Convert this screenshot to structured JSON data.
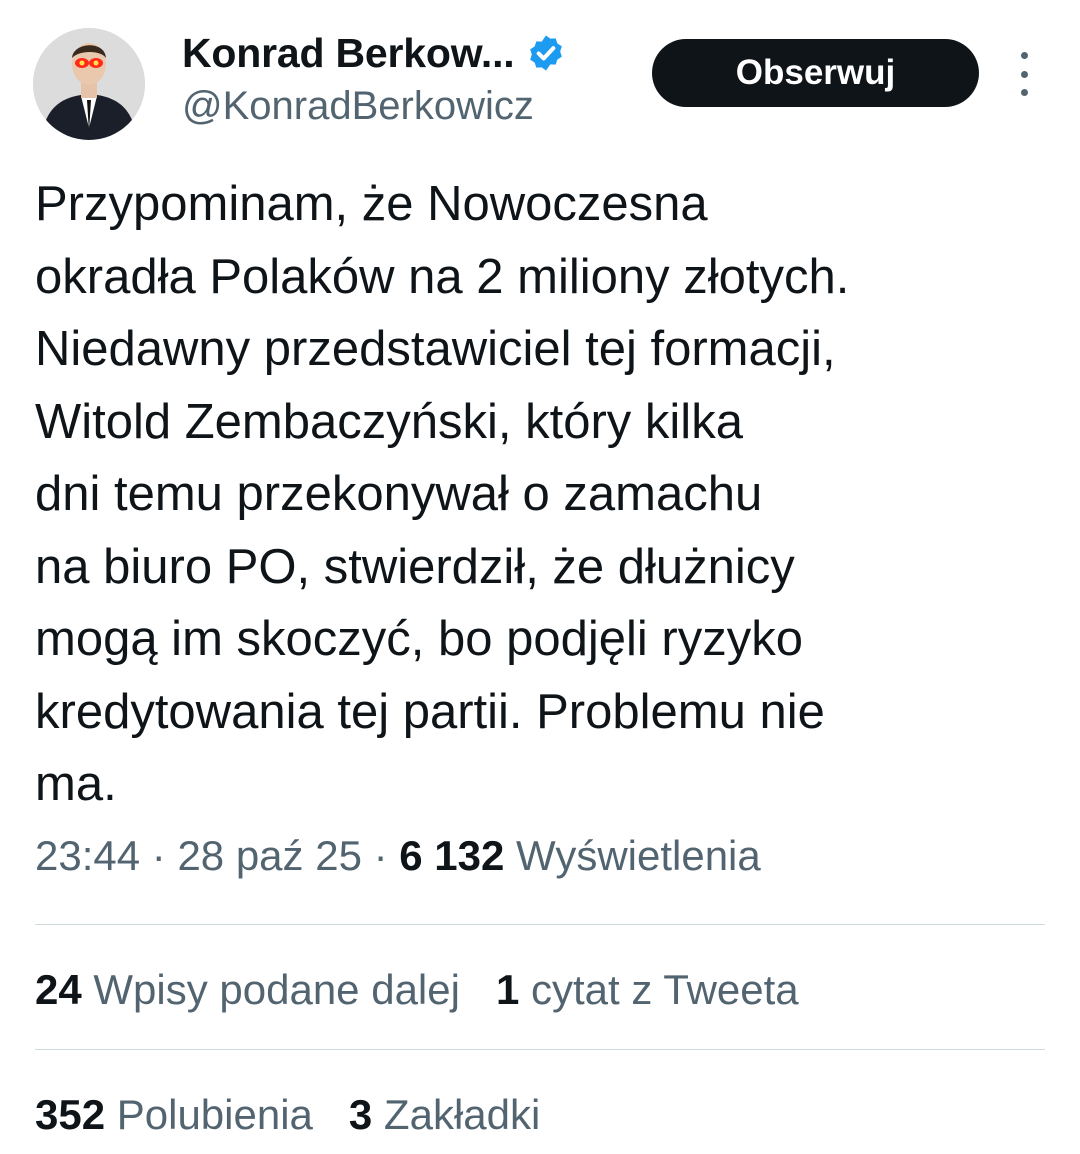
{
  "author": {
    "name": "Konrad Berkow...",
    "handle": "@KonradBerkowicz",
    "verified": true,
    "avatar_icon": "profile-photo",
    "verified_icon": "verified-badge-icon"
  },
  "follow_button": {
    "label": "Obserwuj"
  },
  "more_icon": "more-vertical-icon",
  "tweet": {
    "text": "Przypominam, że Nowoczesna\nokradła Polaków na 2 miliony złotych.\nNiedawny przedstawiciel tej formacji,\nWitold Zembaczyński, który kilka\ndni temu przekonywał o zamachu\nna biuro PO, stwierdził, że dłużnicy\nmogą im skoczyć, bo podjęli ryzyko\nkredytowania tej partii. Problemu nie\nma."
  },
  "meta": {
    "time": "23:44",
    "sep1": " · ",
    "date": "28 paź 25",
    "sep2": " · ",
    "views_count": "6 132",
    "views_label": " Wyświetlenia"
  },
  "stats": {
    "retweets_count": "24",
    "retweets_label": " Wpisy podane dalej",
    "quotes_count": "1",
    "quotes_label": " cytat z Tweeta",
    "likes_count": "352",
    "likes_label": " Polubienia",
    "bookmarks_count": "3",
    "bookmarks_label": " Zakładki"
  },
  "colors": {
    "text_primary": "#0f1419",
    "text_secondary": "#536471",
    "divider": "#cfd9de",
    "verified_blue": "#1d9bf0",
    "button_bg": "#0f1419",
    "button_text": "#ffffff"
  }
}
